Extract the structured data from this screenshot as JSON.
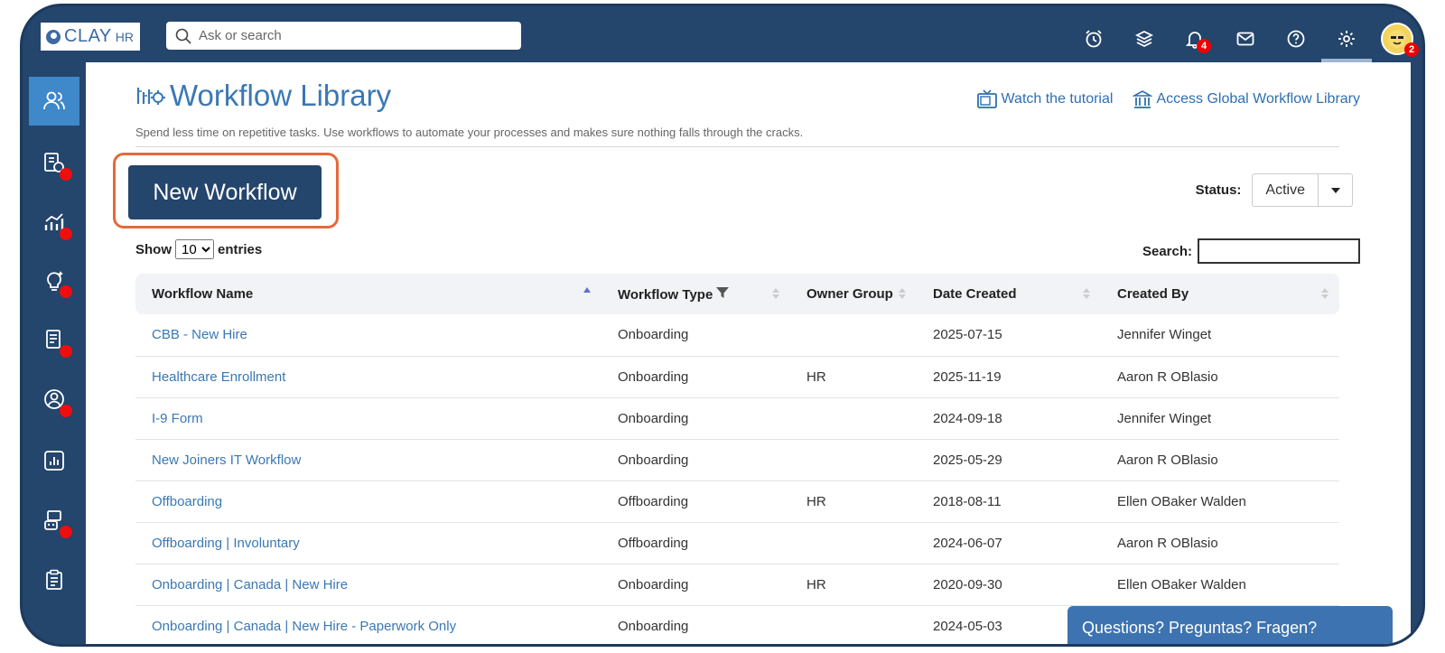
{
  "brand": {
    "name": "CLAY",
    "suffix": "HR"
  },
  "search": {
    "placeholder": "Ask or search"
  },
  "topbar": {
    "icons": [
      {
        "name": "alarm-clock-icon"
      },
      {
        "name": "layers-icon"
      },
      {
        "name": "bell-icon",
        "badge": "4"
      },
      {
        "name": "mail-icon"
      },
      {
        "name": "help-icon"
      },
      {
        "name": "gear-icon",
        "active": true
      }
    ],
    "avatar_badge": "2"
  },
  "sidebar": {
    "items": [
      {
        "name": "people-icon",
        "active": true,
        "dot": false
      },
      {
        "name": "payroll-icon",
        "dot": true
      },
      {
        "name": "analytics-icon",
        "dot": true
      },
      {
        "name": "ideas-icon",
        "dot": true
      },
      {
        "name": "documents-icon",
        "dot": true
      },
      {
        "name": "profile-icon",
        "dot": true
      },
      {
        "name": "reports-icon",
        "dot": false
      },
      {
        "name": "robot-icon",
        "dot": true
      },
      {
        "name": "clipboard-icon",
        "dot": false
      }
    ]
  },
  "page": {
    "title": "Workflow Library",
    "subtitle": "Spend less time on repetitive tasks. Use workflows to automate your processes and makes sure nothing falls through the cracks.",
    "watch_tutorial": "Watch the tutorial",
    "global_library": "Access Global Workflow Library",
    "new_button": "New Workflow",
    "status_label": "Status:",
    "status_value": "Active",
    "show_label": "Show",
    "entries_value": "10",
    "entries_label": "entries",
    "search_label": "Search:"
  },
  "table": {
    "headers": [
      "Workflow Name",
      "Workflow Type",
      "Owner Group",
      "Date Created",
      "Created By"
    ],
    "rows": [
      [
        "CBB - New Hire",
        "Onboarding",
        "",
        "2025-07-15",
        "Jennifer Winget"
      ],
      [
        "Healthcare Enrollment",
        "Onboarding",
        "HR",
        "2025-11-19",
        "Aaron R OBlasio"
      ],
      [
        "I-9 Form",
        "Onboarding",
        "",
        "2024-09-18",
        "Jennifer Winget"
      ],
      [
        "New Joiners IT Workflow",
        "Onboarding",
        "",
        "2025-05-29",
        "Aaron R OBlasio"
      ],
      [
        "Offboarding",
        "Offboarding",
        "HR",
        "2018-08-11",
        "Ellen OBaker Walden"
      ],
      [
        "Offboarding | Involuntary",
        "Offboarding",
        "",
        "2024-06-07",
        "Aaron R OBlasio"
      ],
      [
        "Onboarding | Canada | New Hire",
        "Onboarding",
        "HR",
        "2020-09-30",
        "Ellen OBaker Walden"
      ],
      [
        "Onboarding | Canada | New Hire - Paperwork Only",
        "Onboarding",
        "",
        "2024-05-03",
        ""
      ]
    ]
  },
  "chat": {
    "label": "Questions? Preguntas? Fragen?"
  },
  "colors": {
    "navy": "#24456c",
    "accent": "#3a78b4",
    "highlight": "#e46a3a",
    "badge": "#ee0e0e"
  }
}
